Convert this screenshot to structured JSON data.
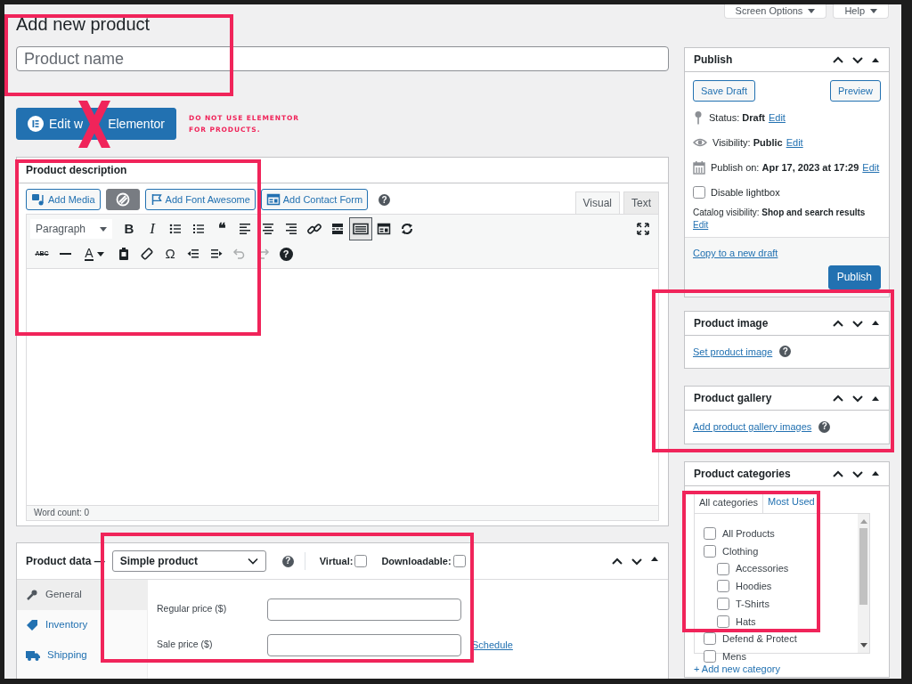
{
  "top_buttons": [
    {
      "label": "Screen Options"
    },
    {
      "label": "Help"
    }
  ],
  "page_title": "Add new product",
  "title_field": {
    "placeholder": "Product name"
  },
  "elementor_button": {
    "label_before_mark": "Edit w",
    "label_after_mark": "Elementor"
  },
  "annotation_note": [
    "DO NOT USE ELEMENTOR",
    "FOR PRODUCTS."
  ],
  "description": {
    "title": "Product description",
    "media_buttons": [
      {
        "kind": "media",
        "label": "Add Media"
      },
      {
        "kind": "plugin"
      },
      {
        "kind": "flag",
        "label": "Add Font Awesome"
      },
      {
        "kind": "form",
        "label": "Add Contact Form"
      }
    ],
    "help": "?",
    "editor_tabs": [
      {
        "label": "Visual",
        "selected": true
      },
      {
        "label": "Text",
        "selected": false
      }
    ],
    "format_select": "Paragraph",
    "toolbar_rows": [
      [
        {
          "kind": "bold",
          "glyph": "B",
          "pressed": false,
          "disabled": false
        },
        {
          "kind": "italic",
          "glyph": "I",
          "pressed": false,
          "disabled": false
        },
        {
          "kind": "bullets",
          "pressed": false,
          "disabled": false
        },
        {
          "kind": "numbers",
          "pressed": false,
          "disabled": false
        },
        {
          "kind": "quote",
          "glyph": "❝",
          "pressed": false,
          "disabled": false
        },
        {
          "kind": "align-left",
          "pressed": false,
          "disabled": false
        },
        {
          "kind": "align-center",
          "pressed": false,
          "disabled": false
        },
        {
          "kind": "align-right",
          "pressed": false,
          "disabled": false
        },
        {
          "kind": "link",
          "pressed": false,
          "disabled": false
        },
        {
          "kind": "more",
          "pressed": false,
          "disabled": false
        },
        {
          "kind": "toggle",
          "pressed": true,
          "disabled": false
        },
        {
          "kind": "form",
          "pressed": false,
          "disabled": false
        },
        {
          "kind": "refresh",
          "pressed": false,
          "disabled": false
        },
        {
          "kind": "fullscreen",
          "pressed": false,
          "disabled": false
        }
      ],
      [
        {
          "kind": "strike",
          "glyph": "ABC",
          "pressed": false,
          "disabled": false
        },
        {
          "kind": "hr",
          "pressed": false,
          "disabled": false
        },
        {
          "kind": "color",
          "glyph": "A",
          "pressed": false,
          "disabled": false
        },
        {
          "kind": "paste",
          "pressed": false,
          "disabled": false
        },
        {
          "kind": "eraser",
          "pressed": false,
          "disabled": false
        },
        {
          "kind": "omega",
          "glyph": "Ω",
          "pressed": false,
          "disabled": false
        },
        {
          "kind": "outdent",
          "pressed": false,
          "disabled": false
        },
        {
          "kind": "indent",
          "pressed": false,
          "disabled": false
        },
        {
          "kind": "undo",
          "pressed": false,
          "disabled": true
        },
        {
          "kind": "redo",
          "pressed": false,
          "disabled": true
        },
        {
          "kind": "help",
          "glyph": "?",
          "pressed": false,
          "disabled": false
        }
      ]
    ],
    "word_count": "Word count: 0"
  },
  "product_data": {
    "title": "Product data —",
    "type_select": "Simple product",
    "help": "?",
    "options": [
      {
        "label": "Virtual:",
        "checked": false
      },
      {
        "label": "Downloadable:",
        "checked": false
      }
    ],
    "tabs": [
      {
        "kind": "wrench",
        "label": "General",
        "selected": true
      },
      {
        "kind": "tag",
        "label": "Inventory",
        "selected": false
      },
      {
        "kind": "truck",
        "label": "Shipping",
        "selected": false
      }
    ],
    "fields": [
      {
        "label": "Regular price ($)"
      },
      {
        "label": "Sale price ($)",
        "link": "Schedule"
      }
    ]
  },
  "publish": {
    "title": "Publish",
    "buttons": [
      {
        "label": "Save Draft"
      },
      {
        "label": "Preview"
      }
    ],
    "rows": [
      {
        "kind": "pin",
        "text": "Status: **Draft**",
        "link": "Edit"
      },
      {
        "kind": "eye",
        "text": "Visibility: **Public**",
        "link": "Edit"
      },
      {
        "kind": "calendar",
        "text": "Publish on: **Apr 17, 2023 at 17:29**",
        "link": "Edit"
      }
    ],
    "lightbox": {
      "label": "Disable lightbox",
      "checked": false
    },
    "catalog": {
      "text": "Catalog visibility: **Shop and search results**",
      "link": "Edit"
    },
    "copy_link": "Copy to a new draft",
    "publish_button": "Publish"
  },
  "product_image": {
    "title": "Product image",
    "link": "Set product image",
    "help": "?"
  },
  "product_gallery": {
    "title": "Product gallery",
    "link": "Add product gallery images",
    "help": "?"
  },
  "categories": {
    "title": "Product categories",
    "tabs": [
      {
        "label": "All categories",
        "selected": true
      },
      {
        "label": "Most Used",
        "selected": false
      }
    ],
    "items": [
      {
        "label": "All Products",
        "checked": false
      },
      {
        "label": "Clothing",
        "checked": false,
        "children": [
          {
            "label": "Accessories",
            "checked": false
          },
          {
            "label": "Hoodies",
            "checked": false
          },
          {
            "label": "T-Shirts",
            "checked": false
          },
          {
            "label": "Hats",
            "checked": false
          }
        ]
      },
      {
        "label": "Defend & Protect",
        "checked": false
      },
      {
        "label": "Mens",
        "checked": false
      }
    ],
    "add_link": "+ Add new category"
  }
}
